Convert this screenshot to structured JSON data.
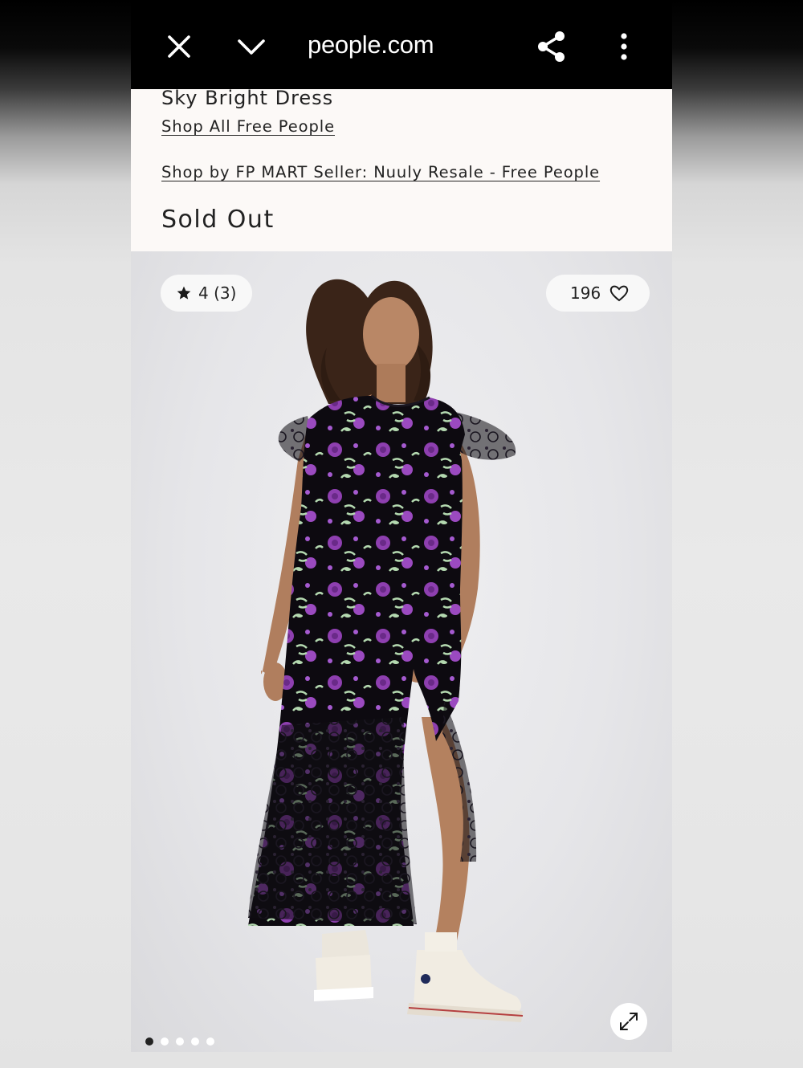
{
  "browser": {
    "url_text": "people.com",
    "close_icon": "close-icon",
    "collapse_icon": "chevron-down-icon",
    "share_icon": "share-icon",
    "menu_icon": "more-vertical-icon"
  },
  "product": {
    "title": "Sky Bright Dress",
    "shop_all_link": "Shop All Free People",
    "seller_link": "Shop by FP MART Seller: Nuuly Resale - Free People",
    "status": "Sold Out"
  },
  "gallery": {
    "rating_text": "4 (3)",
    "rating_value": 4,
    "review_count": 3,
    "likes": "196",
    "image_count": 5,
    "active_image": 1,
    "expand_icon": "expand-icon",
    "colors": {
      "dress": "#0d0a10",
      "flower": "#8e3fb0",
      "leaf": "#b4d9b0",
      "background": "#e6e6e9"
    }
  }
}
